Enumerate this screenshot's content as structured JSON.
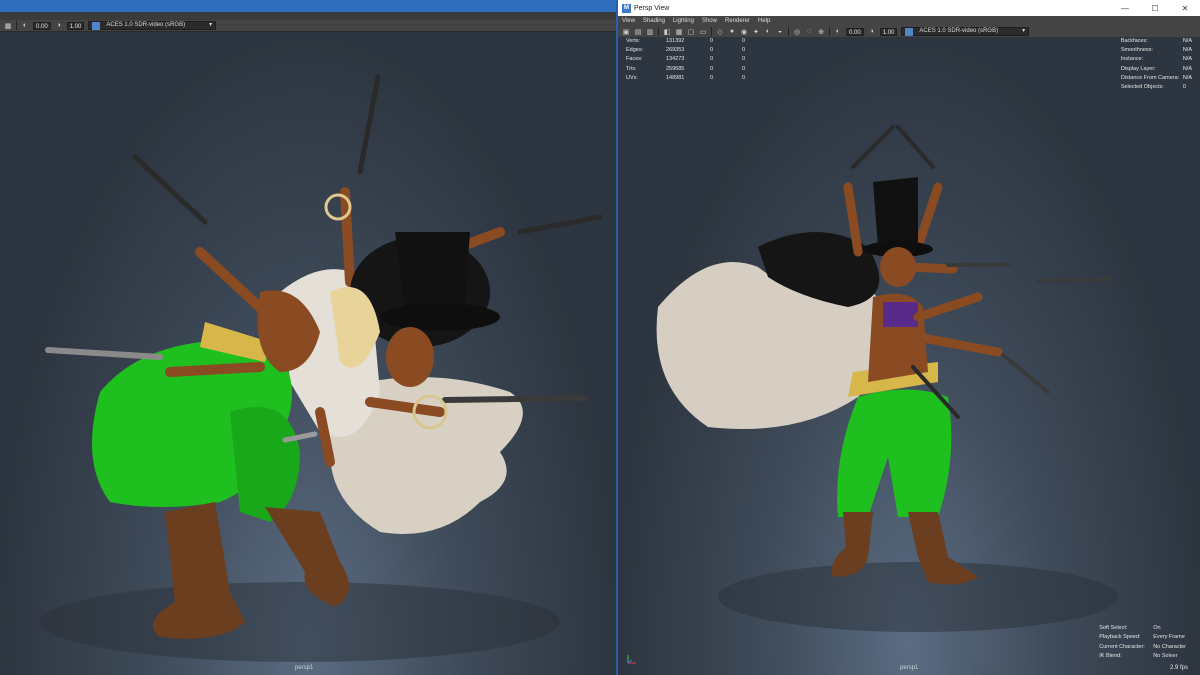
{
  "left": {
    "toolbar": {
      "field_a": "0.00",
      "field_b": "1.00",
      "color_space": "ACES 1.0 SDR-video (sRGB)"
    },
    "camera": "persp1"
  },
  "right": {
    "window_title": "Persp View",
    "menu": [
      "View",
      "Shading",
      "Lighting",
      "Show",
      "Renderer",
      "Help"
    ],
    "toolbar": {
      "field_a": "0.00",
      "field_b": "1.00",
      "color_space": "ACES 1.0 SDR-video (sRGB)"
    },
    "stats": [
      {
        "label": "Verts:",
        "v1": "131392",
        "v2": "0",
        "v3": "0"
      },
      {
        "label": "Edges:",
        "v1": "269353",
        "v2": "0",
        "v3": "0"
      },
      {
        "label": "Faces:",
        "v1": "134273",
        "v2": "0",
        "v3": "0"
      },
      {
        "label": "Tris:",
        "v1": "259685",
        "v2": "0",
        "v3": "0"
      },
      {
        "label": "UVs:",
        "v1": "148981",
        "v2": "0",
        "v3": "0"
      }
    ],
    "hud_top": [
      {
        "label": "Backfaces:",
        "value": "N/A"
      },
      {
        "label": "Smoothness:",
        "value": "N/A"
      },
      {
        "label": "Instance:",
        "value": "N/A"
      },
      {
        "label": "Display Layer:",
        "value": "N/A"
      },
      {
        "label": "Distance From Camera:",
        "value": "N/A"
      },
      {
        "label": "Selected Objects:",
        "value": "0"
      }
    ],
    "hud_bottom": [
      {
        "label": "Soft Select:",
        "value": "On"
      },
      {
        "label": "Playback Speed:",
        "value": "Every Frame"
      },
      {
        "label": "Current Character:",
        "value": "No Character"
      },
      {
        "label": "IK Blend:",
        "value": "No Solver"
      }
    ],
    "fps": "2.9 fps",
    "camera": "persp1"
  }
}
